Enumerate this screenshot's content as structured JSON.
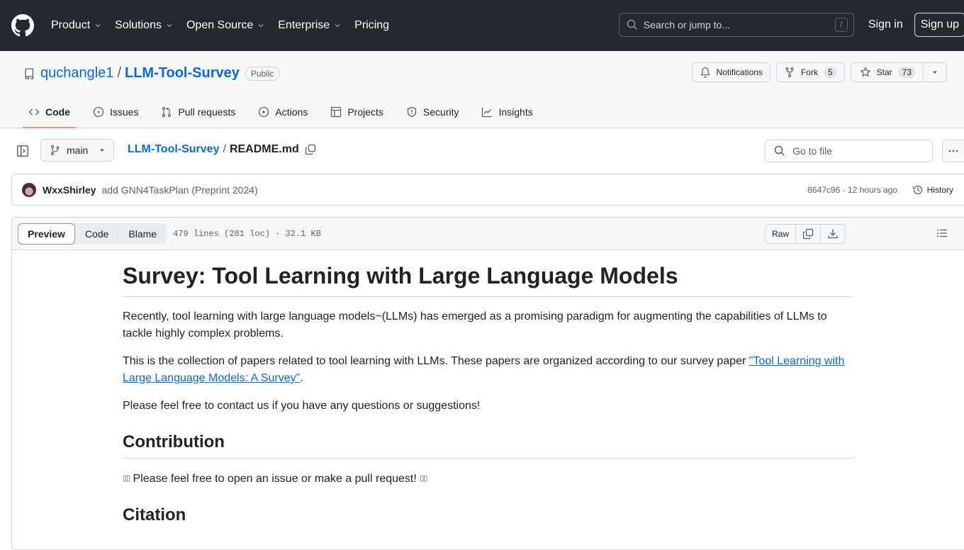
{
  "header": {
    "nav": [
      {
        "label": "Product",
        "has_dropdown": true
      },
      {
        "label": "Solutions",
        "has_dropdown": true
      },
      {
        "label": "Open Source",
        "has_dropdown": true
      },
      {
        "label": "Enterprise",
        "has_dropdown": true
      },
      {
        "label": "Pricing",
        "has_dropdown": false
      }
    ],
    "search_placeholder": "Search or jump to...",
    "search_shortcut": "/",
    "sign_in": "Sign in",
    "sign_up": "Sign up"
  },
  "repo": {
    "owner": "quchangle1",
    "separator": "/",
    "name": "LLM-Tool-Survey",
    "visibility": "Public",
    "actions": {
      "notifications": "Notifications",
      "fork": "Fork",
      "fork_count": "5",
      "star": "Star",
      "star_count": "73"
    },
    "tabs": [
      {
        "label": "Code",
        "icon": "code-icon",
        "active": true
      },
      {
        "label": "Issues",
        "icon": "issue-icon",
        "active": false
      },
      {
        "label": "Pull requests",
        "icon": "pull-request-icon",
        "active": false
      },
      {
        "label": "Actions",
        "icon": "play-icon",
        "active": false
      },
      {
        "label": "Projects",
        "icon": "table-icon",
        "active": false
      },
      {
        "label": "Security",
        "icon": "shield-icon",
        "active": false
      },
      {
        "label": "Insights",
        "icon": "graph-icon",
        "active": false
      }
    ]
  },
  "file_nav": {
    "branch": "main",
    "breadcrumb_repo": "LLM-Tool-Survey",
    "breadcrumb_sep": "/",
    "file_name": "README.md",
    "goto_placeholder": "Go to file"
  },
  "commit": {
    "author": "WxxShirley",
    "message": "add GNN4TaskPlan (Preprint 2024)",
    "meta": "8647c96 · 12 hours ago",
    "history": "History"
  },
  "file_header": {
    "tabs": [
      "Preview",
      "Code",
      "Blame"
    ],
    "active_tab": "Preview",
    "info": "479 lines (281 loc) · 32.1 KB",
    "raw": "Raw"
  },
  "readme": {
    "title": "Survey: Tool Learning with Large Language Models",
    "intro": "Recently, tool learning with large language models~(LLMs) has emerged as a promising paradigm for augmenting the capabilities of LLMs to tackle highly complex problems.",
    "collection_pre": "This is the collection of papers related to tool learning with LLMs. These papers are organized according to our survey paper ",
    "collection_link": "\"Tool Learning with Large Language Models: A Survey\"",
    "collection_post": ".",
    "contact": "Please feel free to contact us if you have any questions or suggestions!",
    "contribution_heading": "Contribution",
    "contribution_glyph": "▯▯",
    "contribution_text": " Please feel free to open an issue or make a pull request! ",
    "citation_heading": "Citation"
  }
}
